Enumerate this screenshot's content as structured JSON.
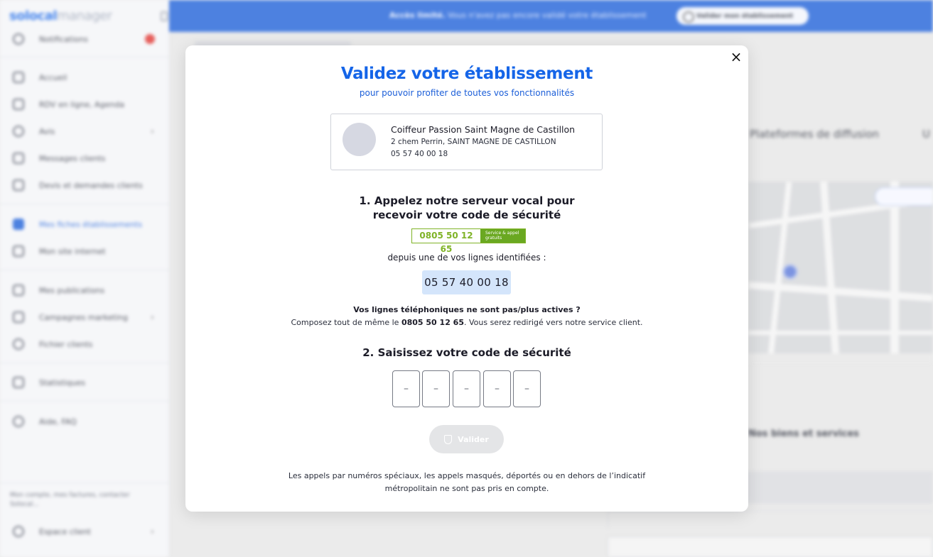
{
  "sidebar": {
    "brand": "solocal",
    "brand_suffix": "manager",
    "items": [
      {
        "label": "Notifications"
      },
      {
        "label": "Accueil"
      },
      {
        "label": "RDV en ligne, Agenda"
      },
      {
        "label": "Avis"
      },
      {
        "label": "Messages clients"
      },
      {
        "label": "Devis et demandes clients"
      },
      {
        "label": "Mes fiches établissements"
      },
      {
        "label": "Mon site internet"
      },
      {
        "label": "Mes publications"
      },
      {
        "label": "Campagnes marketing"
      },
      {
        "label": "Fichier clients"
      },
      {
        "label": "Statistiques"
      },
      {
        "label": "Aide, FAQ"
      },
      {
        "label": "Espace client"
      }
    ],
    "account_text": "Mon compte, mes factures, contacter Solocal..."
  },
  "topbar": {
    "strong": "Accès limité.",
    "text": "Vous n'avez pas encore validé votre établissement",
    "button": "Valider mon établissement"
  },
  "background": {
    "tab": "Plateformes de diffusion",
    "tab_cut": "U",
    "section_heading": "Nos biens et services"
  },
  "modal": {
    "close": "×",
    "title": "Validez votre établissement",
    "subtitle": "pour pouvoir profiter de toutes vos fonctionnalités",
    "business": {
      "name": "Coiffeur Passion Saint Magne de Castillon",
      "address": "2 chem Perrin, SAINT MAGNE DE CASTILLON",
      "phone": "05 57 40 00 18"
    },
    "step1_line1": "1. Appelez notre serveur vocal pour",
    "step1_line2": "recevoir votre code de sécurité",
    "service_number": "0805 50 12 65",
    "service_tag_line1": "Service & appel",
    "service_tag_line2": "gratuits",
    "from_lines": "depuis une de vos lignes identifiées :",
    "identified_line": "05 57 40 00 18",
    "inactive_question": "Vos lignes téléphoniques ne sont pas/plus actives ?",
    "inactive_prefix": "Composez tout de même le",
    "inactive_number": "0805 50 12 65",
    "inactive_suffix": ". Vous serez redirigé vers notre service client.",
    "step2": "2. Saisissez votre code de sécurité",
    "code_placeholder": "–",
    "validate_label": "Valider",
    "footnote": "Les appels par numéros spéciaux, les appels masqués, déportés ou en dehors de l’indicatif métropolitain ne sont pas pris en compte."
  },
  "colors": {
    "primary": "#1b5ed8",
    "title_blue": "#1565e8",
    "service_green": "#7fb326",
    "chip_blue": "#d4e5fb",
    "disabled_button": "#e4e5e7"
  }
}
